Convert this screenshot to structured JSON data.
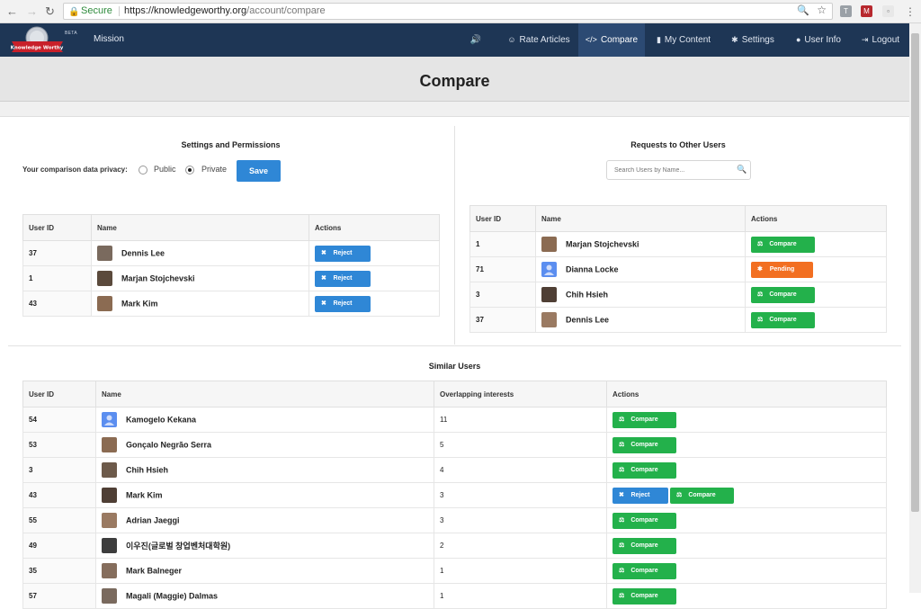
{
  "browser": {
    "back": "←",
    "forward": "→",
    "reload": "↻",
    "secure_label": "Secure",
    "url_host": "https://knowledgeworthy.org",
    "url_path": "/account/compare",
    "zoom_icon": "🔍",
    "star": "☆",
    "menu": "⋮",
    "ext_t": "T",
    "ext_m": "M"
  },
  "nav": {
    "logo_text": "Knowledge Worthy",
    "beta": "BETA",
    "mission": "Mission",
    "sound_icon": "🔊",
    "items": [
      {
        "icon": "☺",
        "label": "Rate Articles"
      },
      {
        "icon": "</>",
        "label": "Compare"
      },
      {
        "icon": "▮",
        "label": "My Content"
      },
      {
        "icon": "✱",
        "label": "Settings"
      },
      {
        "icon": "●",
        "label": "User Info"
      },
      {
        "icon": "⇥",
        "label": "Logout"
      }
    ]
  },
  "page": {
    "title": "Compare"
  },
  "settings": {
    "title": "Settings and Permissions",
    "privacy_label": "Your comparison data privacy:",
    "public_label": "Public",
    "private_label": "Private",
    "selected": "private",
    "save": "Save",
    "columns": [
      "User ID",
      "Name",
      "Actions"
    ],
    "rows": [
      {
        "id": "37",
        "name": "Dennis Lee",
        "action": "Reject"
      },
      {
        "id": "1",
        "name": "Marjan Stojchevski",
        "action": "Reject"
      },
      {
        "id": "43",
        "name": "Mark Kim",
        "action": "Reject"
      }
    ]
  },
  "requests": {
    "title": "Requests to Other Users",
    "search_placeholder": "Search Users by Name...",
    "columns": [
      "User ID",
      "Name",
      "Actions"
    ],
    "rows": [
      {
        "id": "1",
        "name": "Marjan Stojchevski",
        "action": "Compare"
      },
      {
        "id": "71",
        "name": "Dianna Locke",
        "action": "Pending"
      },
      {
        "id": "3",
        "name": "Chih Hsieh",
        "action": "Compare"
      },
      {
        "id": "37",
        "name": "Dennis Lee",
        "action": "Compare"
      }
    ]
  },
  "similar": {
    "title": "Similar Users",
    "columns": [
      "User ID",
      "Name",
      "Overlapping interests",
      "Actions"
    ],
    "reject_label": "Reject",
    "compare_label": "Compare",
    "rows": [
      {
        "id": "54",
        "name": "Kamogelo Kekana",
        "overlap": "11"
      },
      {
        "id": "53",
        "name": "Gonçalo Negrão Serra",
        "overlap": "5"
      },
      {
        "id": "3",
        "name": "Chih Hsieh",
        "overlap": "4"
      },
      {
        "id": "43",
        "name": "Mark Kim",
        "overlap": "3"
      },
      {
        "id": "55",
        "name": "Adrian Jaeggi",
        "overlap": "3"
      },
      {
        "id": "49",
        "name": "이우진(글로벌 창업벤처대학원)",
        "overlap": "2"
      },
      {
        "id": "35",
        "name": "Mark Balneger",
        "overlap": "1"
      },
      {
        "id": "57",
        "name": "Magali (Maggie) Dalmas",
        "overlap": "1"
      }
    ]
  },
  "colors": {
    "navbar": "#1e3655",
    "reject": "#2f87d6",
    "compare": "#23b14b",
    "pending": "#f26f21"
  }
}
